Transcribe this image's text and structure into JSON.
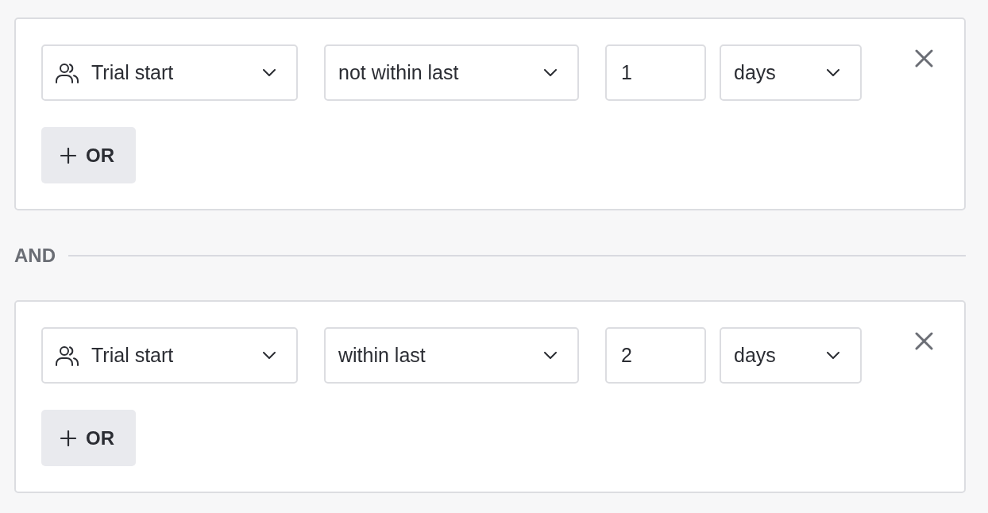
{
  "groups": [
    {
      "rules": [
        {
          "field": "Trial start",
          "operator": "not within last",
          "amount": "1",
          "unit": "days"
        }
      ],
      "add_button": "OR"
    },
    {
      "rules": [
        {
          "field": "Trial start",
          "operator": "within last",
          "amount": "2",
          "unit": "days"
        }
      ],
      "add_button": "OR"
    }
  ],
  "connectors": [
    "AND"
  ]
}
